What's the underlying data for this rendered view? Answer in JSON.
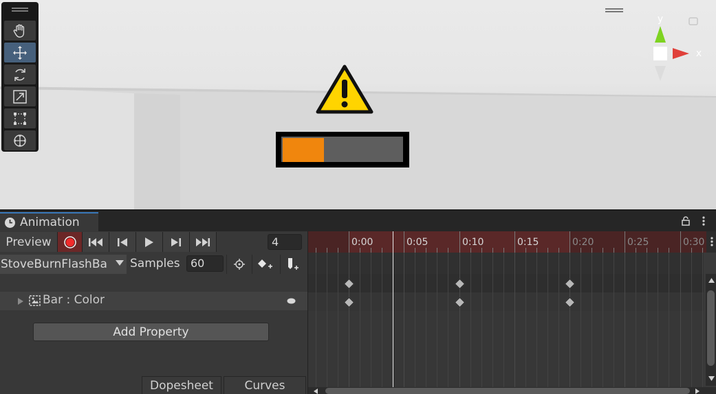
{
  "scene": {
    "tools": [
      {
        "name": "hand-tool",
        "icon": "hand-icon",
        "active": false
      },
      {
        "name": "move-tool",
        "icon": "move-arrows-icon",
        "active": true
      },
      {
        "name": "rotate-tool",
        "icon": "rotate-icon",
        "active": false
      },
      {
        "name": "scale-tool",
        "icon": "scale-icon",
        "active": false
      },
      {
        "name": "rect-tool",
        "icon": "rect-transform-icon",
        "active": false
      },
      {
        "name": "transform-tool",
        "icon": "transform-icon",
        "active": false
      }
    ],
    "warning_icon": "warning-triangle-icon",
    "progress": {
      "fraction": 0.34,
      "fill_color": "#f0860d",
      "track_color": "#5e5e5e"
    },
    "gizmo": {
      "y_label": "y",
      "x_label": "x",
      "view_label": "<"
    }
  },
  "animation": {
    "tab_label": "Animation",
    "toolbar": {
      "preview_label": "Preview",
      "frame_value": "4"
    },
    "clip": {
      "name": "StoveBurnFlashBa",
      "samples_label": "Samples",
      "samples_value": "60"
    },
    "property": {
      "label": "Bar : Color"
    },
    "add_property_label": "Add Property",
    "bottom_tabs": [
      "Dopesheet",
      "Curves"
    ],
    "timeline": {
      "ticks": [
        {
          "label": "0:00",
          "frame": 0,
          "in_range": true
        },
        {
          "label": "0:05",
          "frame": 5,
          "in_range": true
        },
        {
          "label": "0:10",
          "frame": 10,
          "in_range": true
        },
        {
          "label": "0:15",
          "frame": 15,
          "in_range": true
        },
        {
          "label": "0:20",
          "frame": 20,
          "in_range": false
        },
        {
          "label": "0:25",
          "frame": 25,
          "in_range": false
        },
        {
          "label": "0:30",
          "frame": 30,
          "in_range": false
        }
      ],
      "clip_end_frame": 20,
      "current_frame": 4,
      "keyframes": [
        0,
        10,
        20
      ]
    }
  }
}
